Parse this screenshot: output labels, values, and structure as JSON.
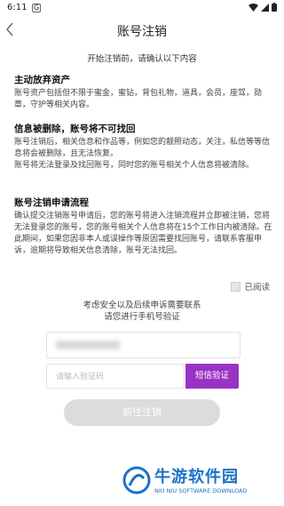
{
  "status": {
    "time": "6:11",
    "g_label": "G"
  },
  "header": {
    "title": "账号注销"
  },
  "intro": "开始注销前，请确认以下内容",
  "sections": [
    {
      "title": "主动放弃资产",
      "lines": [
        "账号资产包括但不限于蜜金，蜜钻，背包礼物，道具，会员，座驾，勋章，守护等相关内容。"
      ]
    },
    {
      "title": "信息被删除，账号将不可找回",
      "lines": [
        "账号注销后，相关信息和作品等，例如您的靓照动态，关注，私信等等信息将会被删除，且无法恢复。",
        "账号将无法登录及找回账号，同时您的账号相关个人信息将被清除。"
      ]
    },
    {
      "title": "账号注销申请流程",
      "lines": [
        "确认提交注销账号申请后，您的账号将进入注销流程并立即被注销，您将无法登录您的账号，您的账号相关个人信息将在15个工作日内被清除。在此期间，如果您因非本人或误操作等原因需要找回账号，请联系客服申诉，逾期将导致相关信息清除，账号无法找回。"
      ]
    }
  ],
  "read_label": "已阅读",
  "verify_notice": [
    "考虑安全以及后续申诉需要联系",
    "请您进行手机号验证"
  ],
  "code_placeholder": "请输入验证码",
  "code_button": "短信验证",
  "submit_button": "前往注销",
  "watermark": {
    "cn": "牛游软件园",
    "en": "NIU NIU SOFTWARE DOWNLOAD"
  },
  "colors": {
    "accent": "#9a33c4",
    "watermark": "#1a73c8",
    "disabled": "#dcdcdc"
  }
}
